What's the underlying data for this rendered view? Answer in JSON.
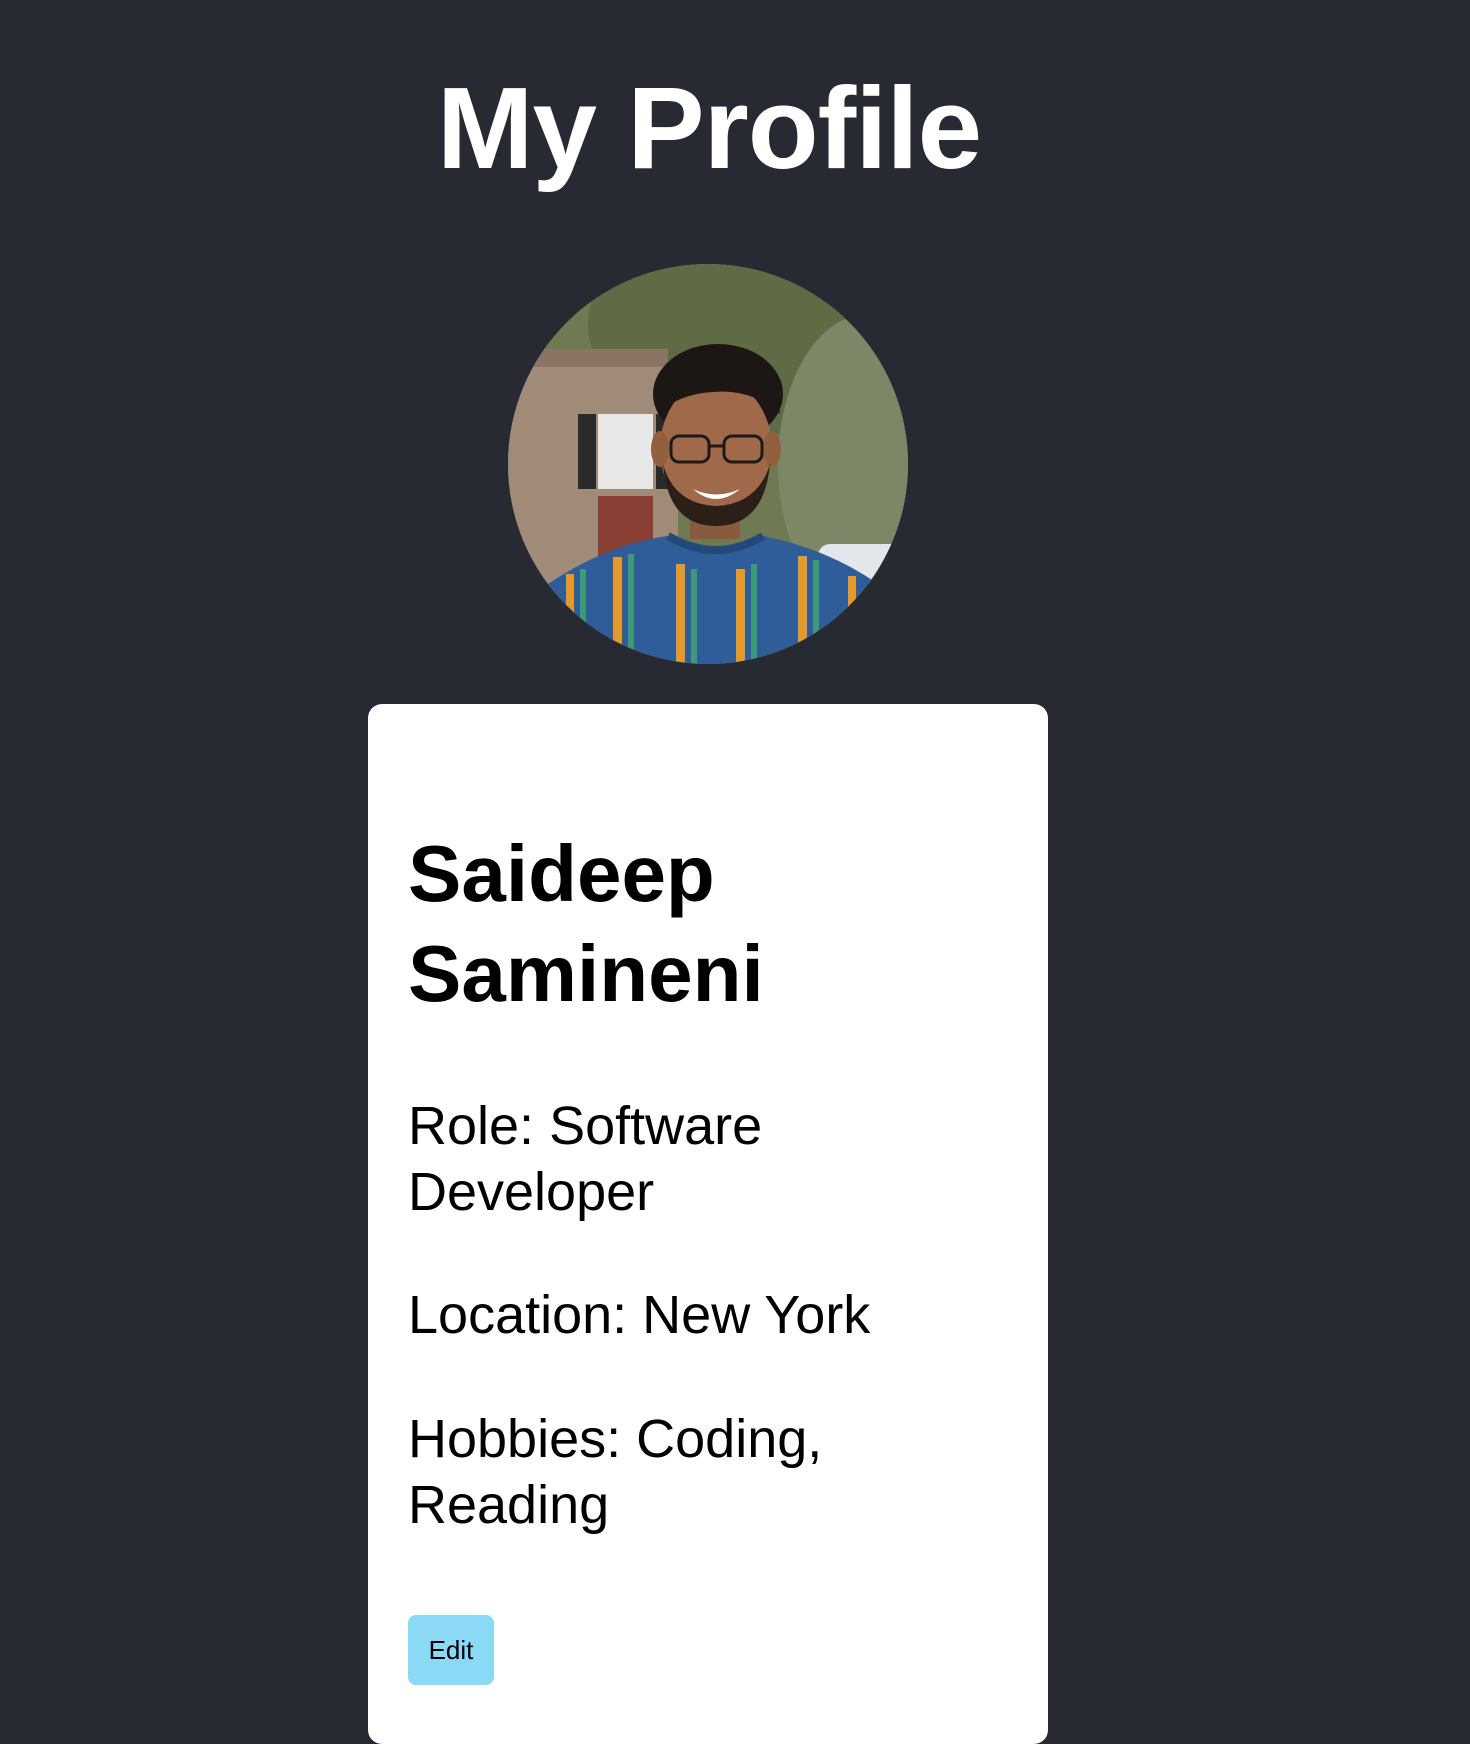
{
  "page": {
    "title": "My Profile"
  },
  "profile": {
    "avatar_alt": "Profile photo",
    "name": "Saideep Samineni",
    "role": "Role: Software Developer",
    "location": "Location: New York",
    "hobbies": "Hobbies: Coding, Reading",
    "edit_label": "Edit"
  },
  "colors": {
    "background": "#282a33",
    "card": "#ffffff",
    "edit_button": "#8ad9f5"
  }
}
